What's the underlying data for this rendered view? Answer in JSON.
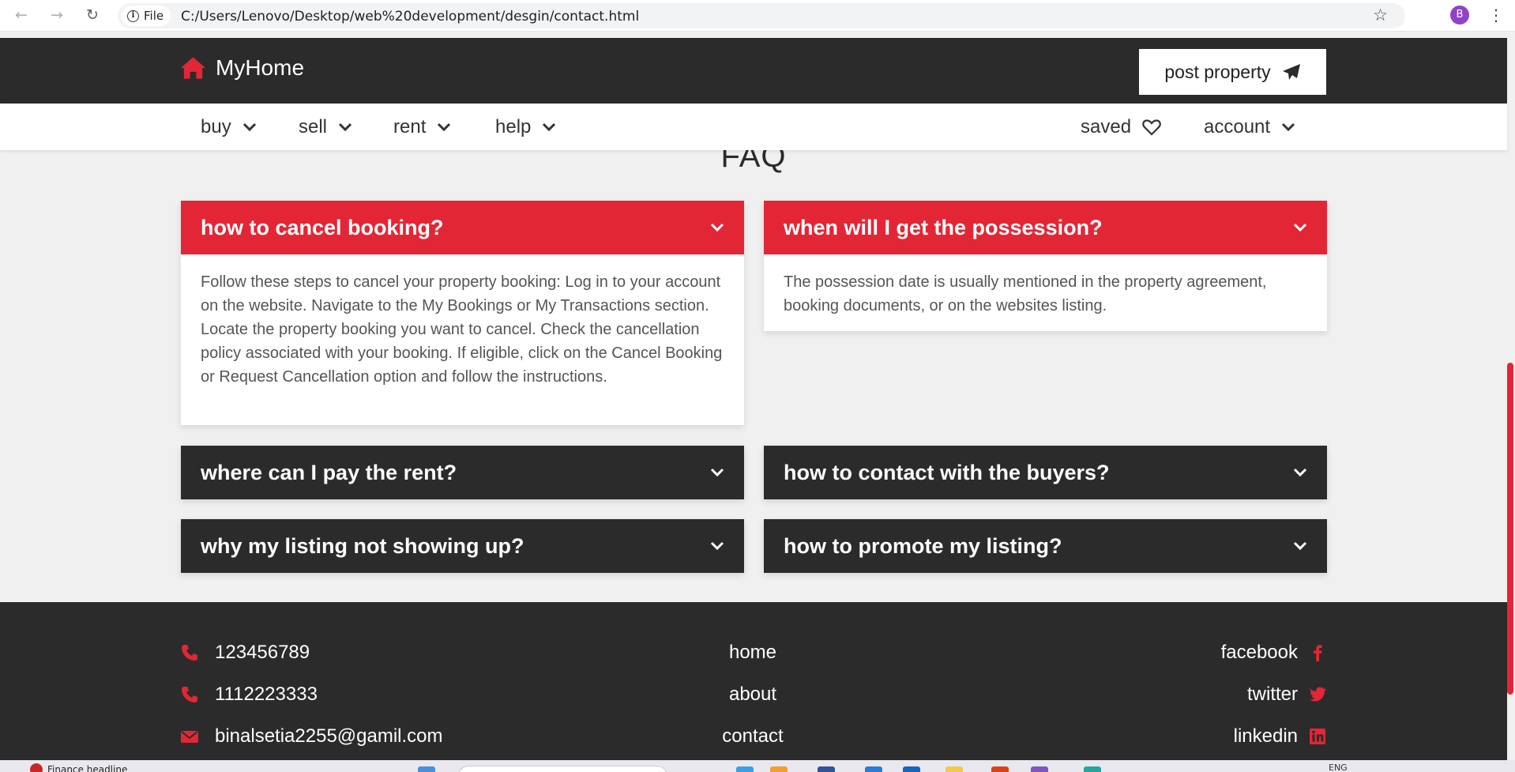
{
  "browser": {
    "site_chip_label": "File",
    "url": "C:/Users/Lenovo/Desktop/web%20development/desgin/contact.html",
    "profile_initial": "B"
  },
  "header": {
    "brand": "MyHome",
    "post_button_label": "post property",
    "accent_color": "#e32636",
    "dark_color": "#2b2b2b"
  },
  "subnav": {
    "left_items": [
      {
        "label": "buy"
      },
      {
        "label": "sell"
      },
      {
        "label": "rent"
      },
      {
        "label": "help"
      }
    ],
    "saved_label": "saved",
    "account_label": "account"
  },
  "faq": {
    "title": "FAQ",
    "items": [
      {
        "question": "how to cancel booking?",
        "answer": "Follow these steps to cancel your property booking: Log in to your account on the website. Navigate to the My Bookings or My Transactions section. Locate the property booking you want to cancel. Check the cancellation policy associated with your booking. If eligible, click on the Cancel Booking or Request Cancellation option and follow the instructions.",
        "expanded": true
      },
      {
        "question": "when will I get the possession?",
        "answer": "The possession date is usually mentioned in the property agreement, booking documents, or on the websites listing.",
        "expanded": true
      },
      {
        "question": "where can I pay the rent?",
        "expanded": false
      },
      {
        "question": "how to contact with the buyers?",
        "expanded": false
      },
      {
        "question": "why my listing not showing up?",
        "expanded": false
      },
      {
        "question": "how to promote my listing?",
        "expanded": false
      }
    ]
  },
  "footer": {
    "phone_1": "123456789",
    "phone_2": "1112223333",
    "email": "binalsetia2255@gamil.com",
    "links": [
      {
        "label": "home"
      },
      {
        "label": "about"
      },
      {
        "label": "contact"
      }
    ],
    "social": [
      {
        "label": "facebook",
        "icon": "facebook-icon"
      },
      {
        "label": "twitter",
        "icon": "twitter-icon"
      },
      {
        "label": "linkedin",
        "icon": "linkedin-icon"
      }
    ]
  },
  "taskbar": {
    "news_label": "Finance headline",
    "language": "ENG"
  }
}
